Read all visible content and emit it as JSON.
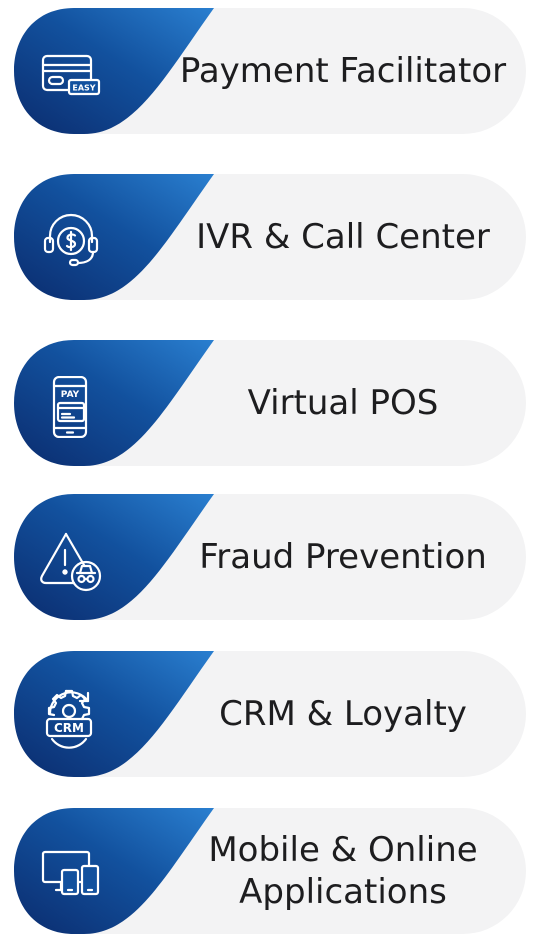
{
  "colors": {
    "leaf_dark": "#0b2c6e",
    "leaf_mid": "#12519e",
    "leaf_light": "#2a7fd0",
    "pill_bg": "#f3f3f4",
    "text": "#1d1d1f",
    "icon": "#ffffff"
  },
  "items": [
    {
      "label": "Payment Facilitator",
      "icon": "credit-card-easy-icon",
      "icon_text": "EASY"
    },
    {
      "label": "IVR & Call Center",
      "icon": "headset-dollar-icon"
    },
    {
      "label": "Virtual POS",
      "icon": "phone-pay-icon",
      "icon_text": "PAY"
    },
    {
      "label": "Fraud Prevention",
      "icon": "warning-spy-icon"
    },
    {
      "label": "CRM & Loyalty",
      "icon": "gear-crm-icon",
      "icon_text": "CRM"
    },
    {
      "label": "Mobile & Online Applications",
      "icon": "devices-icon"
    }
  ]
}
